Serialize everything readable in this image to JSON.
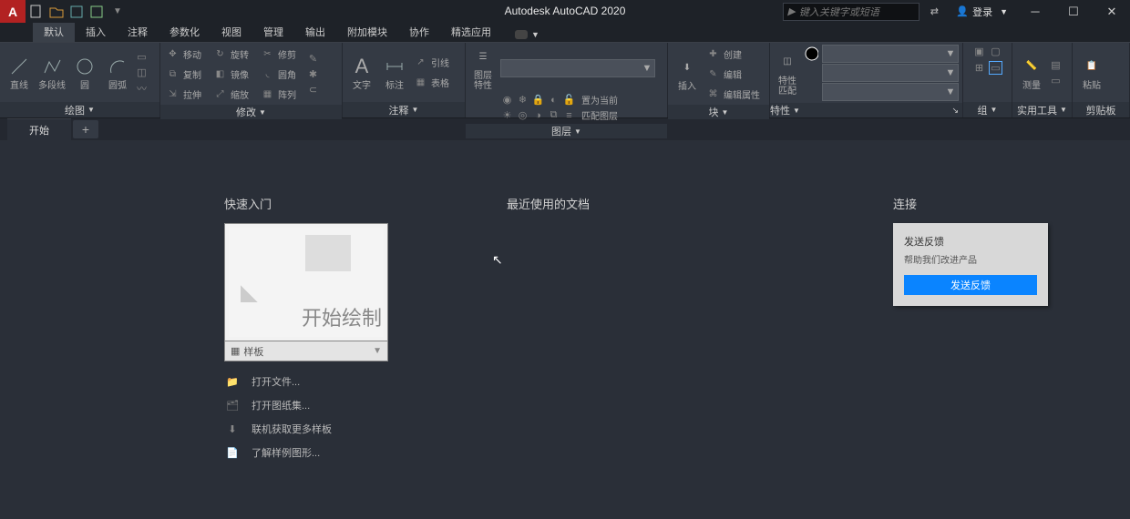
{
  "title": "Autodesk AutoCAD 2020",
  "qat": {
    "dropdown": "▼"
  },
  "search": {
    "placeholder": "键入关键字或短语"
  },
  "account": {
    "label": "登录"
  },
  "tabs": {
    "default": "默认",
    "items": [
      "插入",
      "注释",
      "参数化",
      "视图",
      "管理",
      "输出",
      "附加模块",
      "协作",
      "精选应用"
    ]
  },
  "ribbon": {
    "draw": {
      "title": "绘图",
      "line": "直线",
      "polyline": "多段线",
      "circle": "圆",
      "arc": "圆弧"
    },
    "modify": {
      "title": "修改",
      "move": "移动",
      "rotate": "旋转",
      "trim": "修剪",
      "copy": "复制",
      "mirror": "镜像",
      "fillet": "圆角",
      "stretch": "拉伸",
      "scale": "缩放",
      "array": "阵列"
    },
    "annot": {
      "title": "注释",
      "text": "文字",
      "dim": "标注",
      "leader": "引线",
      "table": "表格"
    },
    "layer": {
      "title": "图层",
      "props": "图层\n特性",
      "current": "置为当前",
      "match": "匹配图层"
    },
    "block": {
      "title": "块",
      "insert": "插入",
      "create": "创建",
      "edit": "编辑",
      "editattr": "编辑属性"
    },
    "props": {
      "title": "特性",
      "match": "特性\n匹配"
    },
    "group": {
      "title": "组"
    },
    "util": {
      "title": "实用工具",
      "measure": "测量"
    },
    "clip": {
      "title": "剪贴板",
      "paste": "粘贴"
    }
  },
  "doctab": {
    "start": "开始"
  },
  "start": {
    "quick": {
      "title": "快速入门",
      "begin": "开始绘制",
      "templates": "样板",
      "open_file": "打开文件...",
      "open_sheetset": "打开图纸集...",
      "get_templates": "联机获取更多样板",
      "samples": "了解样例图形..."
    },
    "recent": {
      "title": "最近使用的文档"
    },
    "connect": {
      "title": "连接",
      "feedback_title": "发送反馈",
      "feedback_sub": "帮助我们改进产品",
      "feedback_btn": "发送反馈"
    }
  }
}
